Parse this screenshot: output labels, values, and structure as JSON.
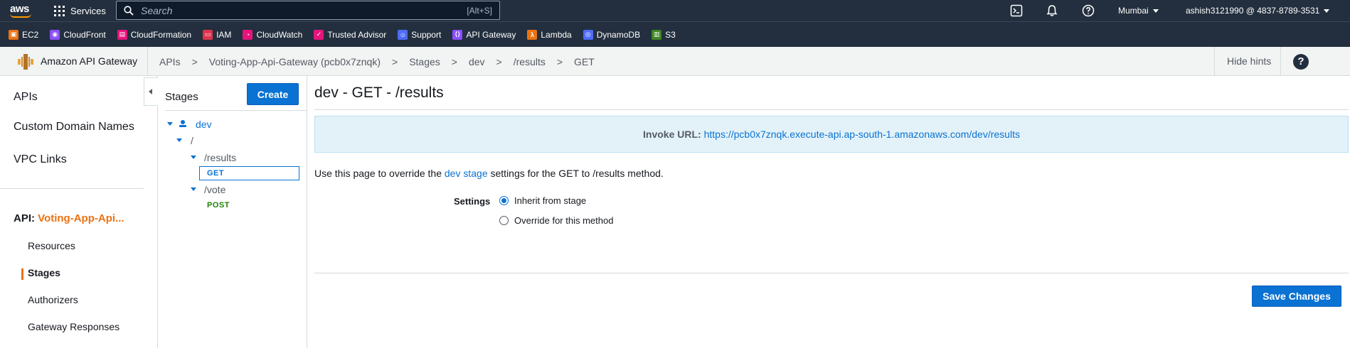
{
  "topnav": {
    "logo_text": "aws",
    "services_label": "Services",
    "search_placeholder": "Search",
    "search_shortcut": "[Alt+S]",
    "region": "Mumbai",
    "account": "ashish3121990 @ 4837-8789-3531"
  },
  "favorites": [
    {
      "label": "EC2",
      "icon": "ec2-icon",
      "color": "#ec7211"
    },
    {
      "label": "CloudFront",
      "icon": "cloudfront-icon",
      "color": "#8c4fff"
    },
    {
      "label": "CloudFormation",
      "icon": "cloudformation-icon",
      "color": "#e7157b"
    },
    {
      "label": "IAM",
      "icon": "iam-icon",
      "color": "#dd344c"
    },
    {
      "label": "CloudWatch",
      "icon": "cloudwatch-icon",
      "color": "#e7157b"
    },
    {
      "label": "Trusted Advisor",
      "icon": "trusted-advisor-icon",
      "color": "#e7157b"
    },
    {
      "label": "Support",
      "icon": "support-icon",
      "color": "#4f6bfa"
    },
    {
      "label": "API Gateway",
      "icon": "api-gateway-icon",
      "color": "#8c4fff"
    },
    {
      "label": "Lambda",
      "icon": "lambda-icon",
      "color": "#ec7211"
    },
    {
      "label": "DynamoDB",
      "icon": "dynamodb-icon",
      "color": "#4f6bfa"
    },
    {
      "label": "S3",
      "icon": "s3-icon",
      "color": "#3f8624"
    }
  ],
  "breadcrumb_bar": {
    "service_name": "Amazon API Gateway",
    "crumbs": [
      "APIs",
      "Voting-App-Api-Gateway (pcb0x7znqk)",
      "Stages",
      "dev",
      "/results",
      "GET"
    ],
    "separator": ">",
    "hide_hints": "Hide hints",
    "help": "?"
  },
  "sidebar": {
    "items": [
      "APIs",
      "Custom Domain Names",
      "VPC Links"
    ],
    "api_prefix": "API:",
    "api_name": "Voting-App-Api...",
    "sub_items": [
      "Resources",
      "Stages",
      "Authorizers",
      "Gateway Responses"
    ],
    "active_sub_item": "Stages"
  },
  "stages_panel": {
    "title": "Stages",
    "create_label": "Create",
    "tree": {
      "stage": "dev",
      "root": "/",
      "results": "/results",
      "results_method": "GET",
      "vote": "/vote",
      "vote_method": "POST"
    }
  },
  "main": {
    "title": "dev - GET - /results",
    "invoke_label": "Invoke URL:",
    "invoke_url": "https://pcb0x7znqk.execute-api.ap-south-1.amazonaws.com/dev/results",
    "help_prefix": "Use this page to override the",
    "help_link": "dev stage",
    "help_suffix": "settings for the GET to /results method.",
    "settings_label": "Settings",
    "options": [
      "Inherit from stage",
      "Override for this method"
    ],
    "selected_option": "Inherit from stage",
    "save_label": "Save Changes"
  },
  "colors": {
    "nav_bg": "#232f3e",
    "accent_orange": "#ec7211",
    "link_blue": "#0972d3",
    "info_bg": "#e3f2f9",
    "post_green": "#1d8102"
  }
}
